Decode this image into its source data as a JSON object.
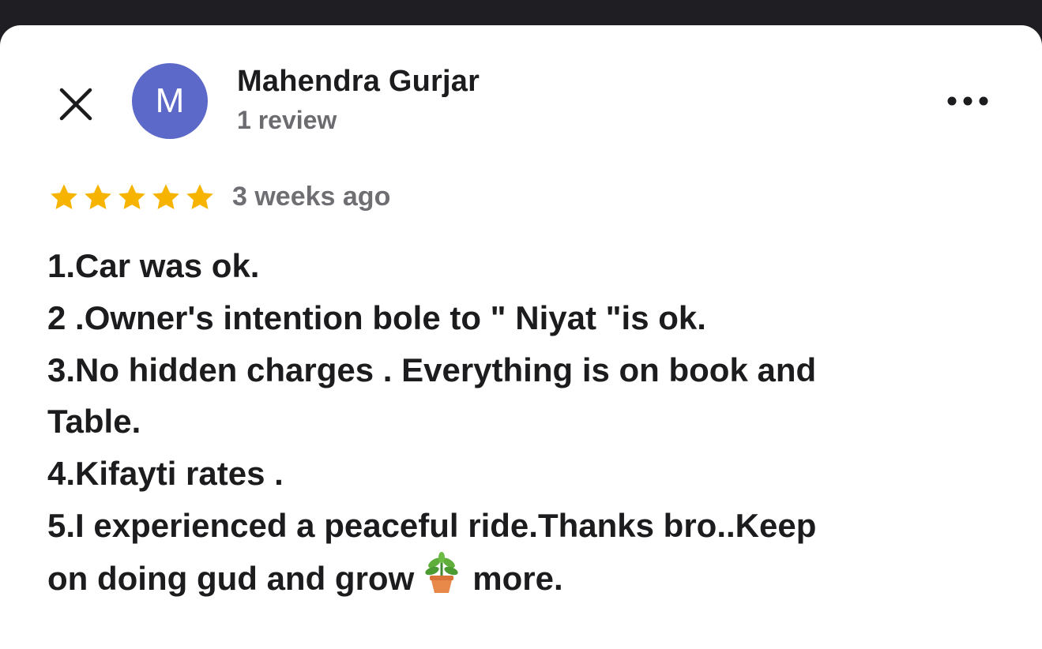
{
  "reviewer": {
    "avatar_initial": "M",
    "avatar_color": "#5d69c8",
    "name": "Mahendra Gurjar",
    "review_count": "1 review"
  },
  "icons": {
    "close": "close-icon",
    "more": "more-options-icon",
    "star": "star-icon",
    "plant": "potted-plant-icon"
  },
  "review": {
    "rating": 5,
    "rating_max": 5,
    "star_color": "#f6b400",
    "date": "3 weeks ago",
    "lines": [
      "1.Car was ok.",
      "2 .Owner's intention bole to \" Niyat \"is ok.",
      "3.No hidden charges . Everything is on book and",
      "Table.",
      "4.Kifayti rates .",
      "5.I experienced a peaceful ride.Thanks bro..Keep",
      "on doing gud and grow",
      "more."
    ]
  }
}
